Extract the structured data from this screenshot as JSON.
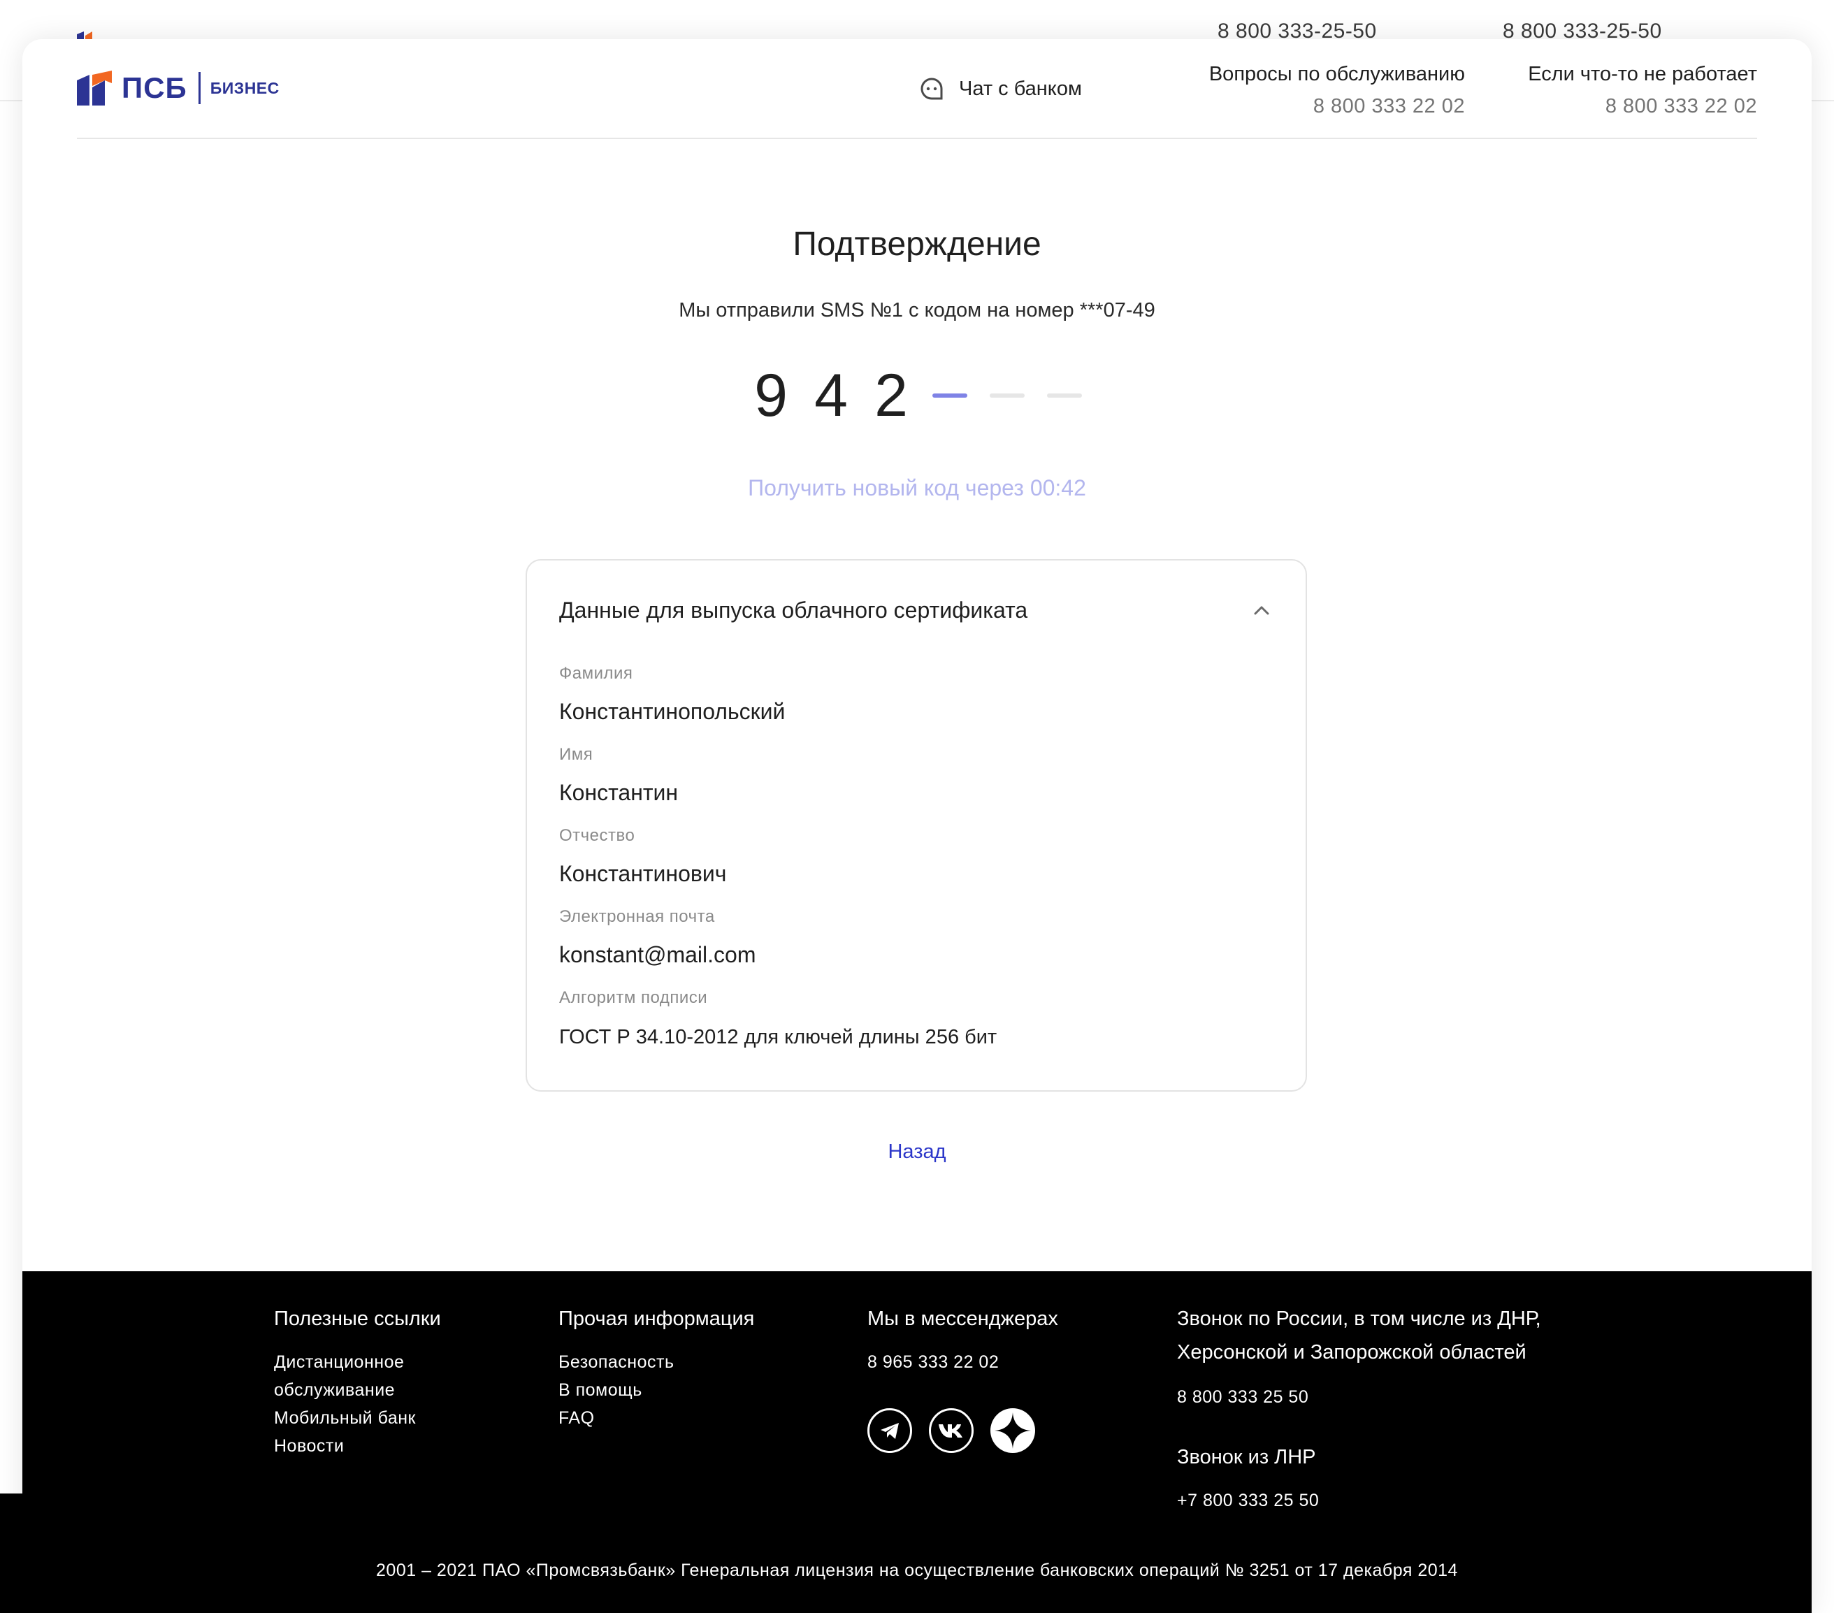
{
  "underlay": {
    "phone_1": "8 800 333-25-50",
    "phone_2": "8 800 333-25-50"
  },
  "header": {
    "logo_text": "ПСБ",
    "logo_sub": "БИЗНЕС",
    "chat_label": "Чат с банком",
    "contacts": [
      {
        "title": "Вопросы по обслуживанию",
        "phone": "8 800 333 22 02"
      },
      {
        "title": "Если что-то не работает",
        "phone": "8 800 333 22 02"
      }
    ]
  },
  "confirmation": {
    "title": "Подтверждение",
    "subtitle": "Мы отправили SMS №1 с кодом на номер ***07-49",
    "code_digits": [
      "9",
      "4",
      "2"
    ],
    "resend": "Получить новый код через 00:42"
  },
  "certificate": {
    "title": "Данные для выпуска облачного сертификата",
    "fields": [
      {
        "label": "Фамилия",
        "value": "Константинопольский"
      },
      {
        "label": "Имя",
        "value": "Константин"
      },
      {
        "label": "Отчество",
        "value": "Константинович"
      },
      {
        "label": "Электронная почта",
        "value": "konstant@mail.com"
      },
      {
        "label": "Алгоритм подписи",
        "value": "ГОСТ Р 34.10-2012 для ключей длины 256 бит"
      }
    ]
  },
  "back_label": "Назад",
  "footer": {
    "useful": {
      "title": "Полезные ссылки",
      "links": [
        "Дистанционное",
        "обслуживание",
        "Мобильный банк",
        "Новости"
      ]
    },
    "other": {
      "title": "Прочая информация",
      "links": [
        "Безопасность",
        "В помощь",
        "FAQ"
      ]
    },
    "messengers": {
      "title": "Мы в мессенджерах",
      "phone": "8 965 333 22 02",
      "icons": [
        "telegram-icon",
        "vk-icon",
        "star-icon"
      ]
    },
    "russia": {
      "title_line1": "Звонок по России, в том числе из ДНР,",
      "title_line2": "Херсонской и Запорожской областей",
      "phone": "8 800 333 25 50"
    },
    "lnr": {
      "title": "Звонок из ЛНР",
      "phone": "+7 800 333 25 50"
    },
    "copyright": "2001 – 2021 ПАО «Промсвязьбанк» Генеральная лицензия на осуществление банковских операций № 3251 от 17 декабря 2014"
  },
  "colors": {
    "brand_blue": "#2c3494",
    "brand_orange": "#f26722",
    "accent_active": "#7f83e6",
    "link": "#2b36c9",
    "muted_link": "#b3b6ee"
  }
}
